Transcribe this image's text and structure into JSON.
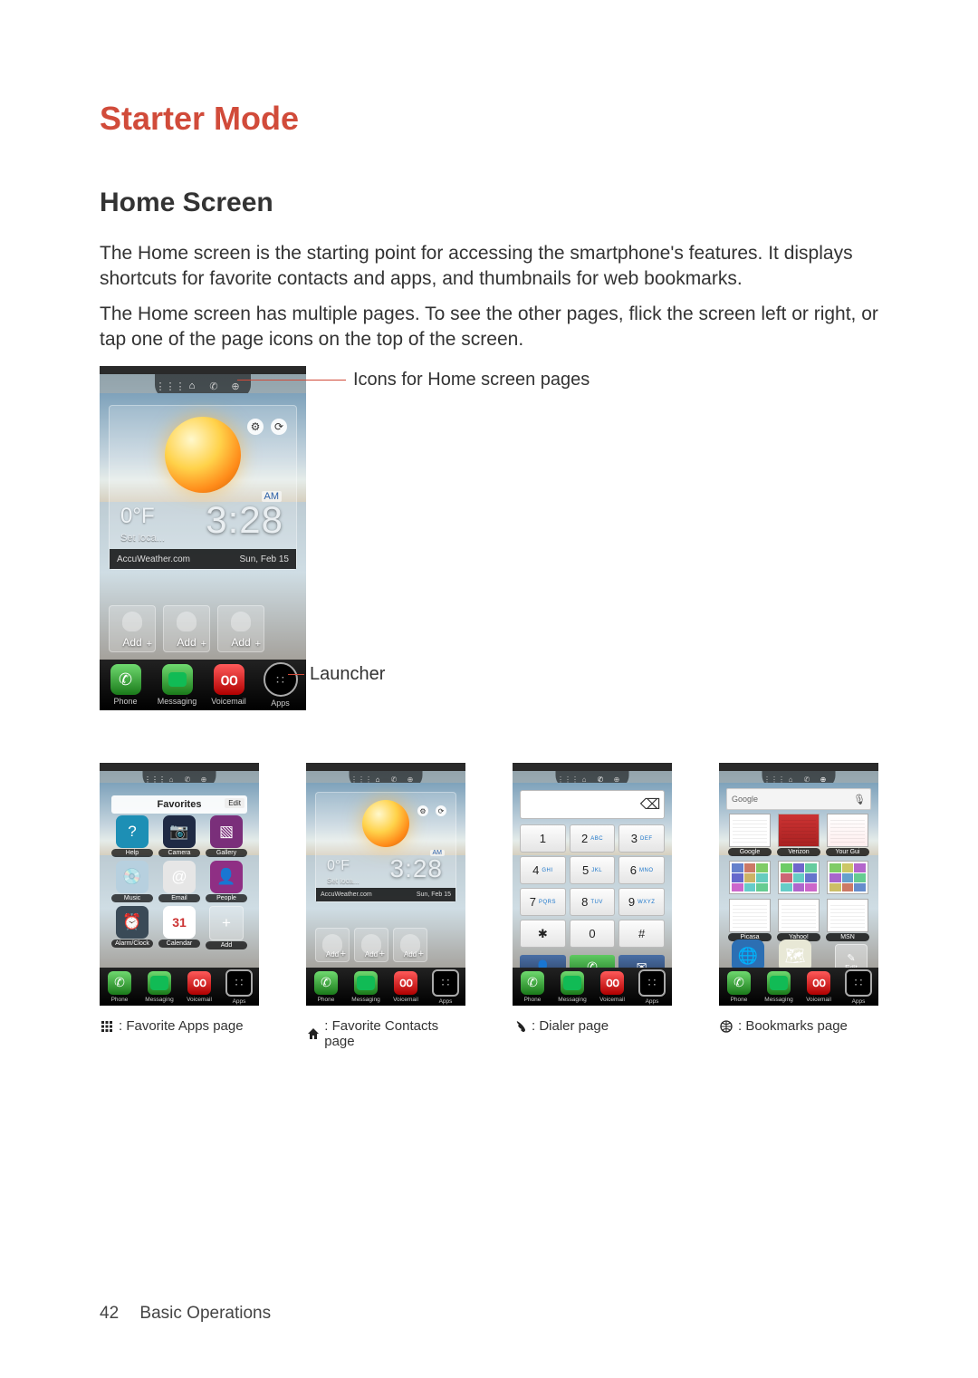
{
  "title": "Starter Mode",
  "section": "Home Screen",
  "para1": "The Home screen is the starting point for accessing the smartphone's features. It displays shortcuts for favorite contacts and apps, and thumbnails for web bookmarks.",
  "para2": "The Home screen has multiple pages. To see the other pages, flick the screen left or right, or tap one of the page icons on the top of the screen.",
  "callout_pages": "Icons for Home screen pages",
  "callout_launcher": "Launcher",
  "weather": {
    "temp": "0°F",
    "setloc": "Set loca...",
    "time": "3:28",
    "ampm": "AM",
    "provider": "AccuWeather.com",
    "date": "Sun, Feb 15"
  },
  "add_label": "Add",
  "dock": {
    "phone": "Phone",
    "messaging": "Messaging",
    "voicemail": "Voicemail",
    "apps": "Apps"
  },
  "favorites": {
    "title": "Favorites",
    "edit": "Edit",
    "items": [
      {
        "label": "Help",
        "bg": "#1d8fb5",
        "glyph": "?"
      },
      {
        "label": "Camera",
        "bg": "#1f2a44",
        "glyph": "📷"
      },
      {
        "label": "Gallery",
        "bg": "#7a2f7a",
        "glyph": "▧"
      },
      {
        "label": "Music",
        "bg": "#b7d0df",
        "glyph": "💿"
      },
      {
        "label": "Email",
        "bg": "#e6e6e6",
        "glyph": "@"
      },
      {
        "label": "People",
        "bg": "#8f2f84",
        "glyph": "👤"
      },
      {
        "label": "Alarm/Clock",
        "bg": "#3a4a57",
        "glyph": "⏰"
      },
      {
        "label": "Calendar",
        "bg": "#ffffff",
        "glyph": "31"
      }
    ],
    "add": "Add"
  },
  "dialer": {
    "keys": [
      {
        "d": "1",
        "s": ""
      },
      {
        "d": "2",
        "s": "ABC"
      },
      {
        "d": "3",
        "s": "DEF"
      },
      {
        "d": "4",
        "s": "GHI"
      },
      {
        "d": "5",
        "s": "JKL"
      },
      {
        "d": "6",
        "s": "MNO"
      },
      {
        "d": "7",
        "s": "PQRS"
      },
      {
        "d": "8",
        "s": "TUV"
      },
      {
        "d": "9",
        "s": "WXYZ"
      },
      {
        "d": "✱",
        "s": ""
      },
      {
        "d": "0",
        "s": ""
      },
      {
        "d": "#",
        "s": ""
      }
    ]
  },
  "bookmarks": {
    "search_label": "Google",
    "row1": [
      {
        "label": "Google"
      },
      {
        "label": "Verizon"
      },
      {
        "label": "Your Gui"
      }
    ],
    "row2": [
      {
        "label": "Picasa"
      },
      {
        "label": "Yahoo!"
      },
      {
        "label": "MSN"
      }
    ],
    "big": [
      {
        "label": "Browser",
        "bg": "#2c6fb3",
        "glyph": "🌐"
      },
      {
        "label": "Maps",
        "bg": "#e8e8d6",
        "glyph": "🗺"
      }
    ],
    "edit": "Edit"
  },
  "legend": {
    "fav_apps": ": Favorite Apps page",
    "fav_contacts": ": Favorite Contacts page",
    "dialer": ": Dialer page",
    "bookmarks": ": Bookmarks page"
  },
  "footer": {
    "page": "42",
    "chapter": "Basic Operations"
  }
}
